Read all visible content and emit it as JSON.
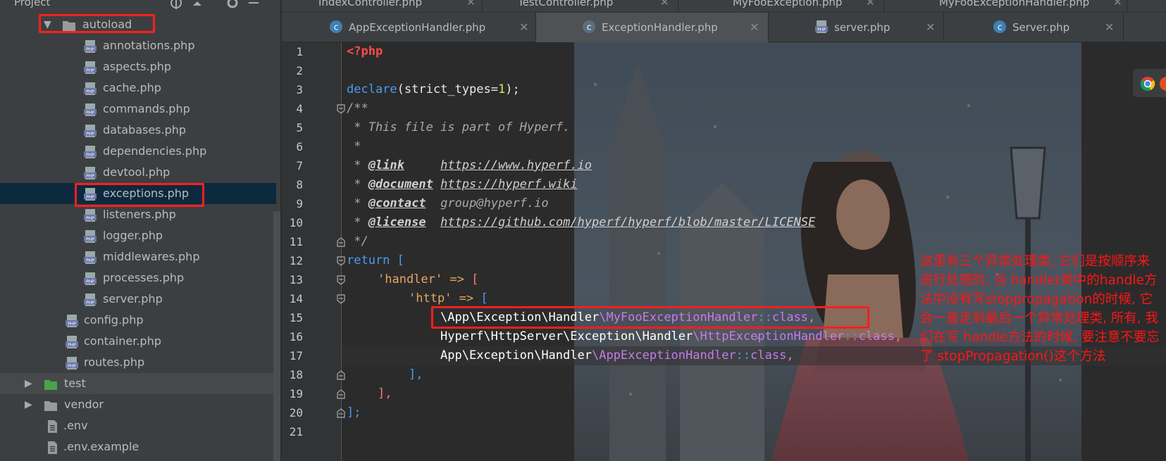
{
  "sidebar": {
    "header": "Project",
    "folder_open": "autoload",
    "autoload_files": [
      "annotations.php",
      "aspects.php",
      "cache.php",
      "commands.php",
      "databases.php",
      "dependencies.php",
      "devtool.php",
      "exceptions.php",
      "listeners.php",
      "logger.php",
      "middlewares.php",
      "processes.php",
      "server.php"
    ],
    "config_files": [
      "config.php",
      "container.php",
      "routes.php"
    ],
    "folders": [
      "test",
      "vendor"
    ],
    "root_files": [
      ".env",
      ".env.example"
    ],
    "selected_file": "exceptions.php"
  },
  "tabs_top": [
    "IndexController.php",
    "TestController.php",
    "MyFooException.php",
    "MyFooExceptionHandler.php"
  ],
  "tabs": [
    {
      "label": "AppExceptionHandler.php",
      "icon": "class-icon"
    },
    {
      "label": "ExceptionHandler.php",
      "icon": "abstract-class-icon"
    },
    {
      "label": "server.php",
      "icon": "php-file-icon"
    },
    {
      "label": "Server.php",
      "icon": "class-icon"
    }
  ],
  "editor": {
    "line_numbers": [
      "1",
      "2",
      "3",
      "4",
      "5",
      "6",
      "7",
      "8",
      "9",
      "10",
      "11",
      "12",
      "13",
      "14",
      "15",
      "16",
      "17",
      "18",
      "19",
      "20",
      "21"
    ],
    "code": {
      "l1": "<?php",
      "l3_kw": "declare",
      "l3_a": "(strict_types=",
      "l3_num": "1",
      "l3_b": ");",
      "l4": "/**",
      "l5": " * This file is part of Hyperf.",
      "l6": " *",
      "l7_a": " * ",
      "l7_tag": "@link",
      "l7_sp": "     ",
      "l7_url": "https://www.hyperf.io",
      "l8_a": " * ",
      "l8_tag": "@document",
      "l8_sp": " ",
      "l8_url": "https://hyperf.wiki",
      "l9_a": " * ",
      "l9_tag": "@contact",
      "l9_sp": "  ",
      "l9_val": "group@hyperf.io",
      "l10_a": " * ",
      "l10_tag": "@license",
      "l10_sp": "  ",
      "l10_url": "https://github.com/hyperf/hyperf/blob/master/LICENSE",
      "l11": " */",
      "l12_kw": "return",
      "l12_b": " [",
      "l13_str": "'handler'",
      "l13_op": " => ",
      "l13_b": "[",
      "l14_str": "'http'",
      "l14_op": " => ",
      "l14_b": "[",
      "l15": {
        "p1": "\\App",
        "p2": "\\Exception",
        "p3": "\\Handler",
        "cls": "\\MyFooExceptionHandler",
        "sep": "::",
        "kw": "class",
        "end": ","
      },
      "l16": {
        "p1": "Hyperf",
        "p2": "\\HttpServer",
        "p3": "\\Exception",
        "p4": "\\Handler",
        "cls": "\\HttpExceptionHandler",
        "sep": "::",
        "kw": "class",
        "end": ","
      },
      "l17": {
        "p1": "App",
        "p2": "\\Exception",
        "p3": "\\Handler",
        "cls": "\\AppExceptionHandler",
        "sep": "::",
        "kw": "class",
        "end": ","
      },
      "l18": "],",
      "l19": "],",
      "l20": "];"
    }
  },
  "annotation_note": "这里有三个异常处理类, 它们是按顺序来进行处理的, 当 handler类中的handle方法中没有写stoppropagation的时候, 它会一直走到最后一个异常处理类, 所有, 我们在写 handle方法的时候, 要注意不要忘了  stopPropagation()这个方法",
  "colors": {
    "annotation": "#ff1f1f",
    "sidebar_bg": "#3c3f41",
    "editor_bg": "#2b2b2b",
    "selection": "#0d293e"
  }
}
